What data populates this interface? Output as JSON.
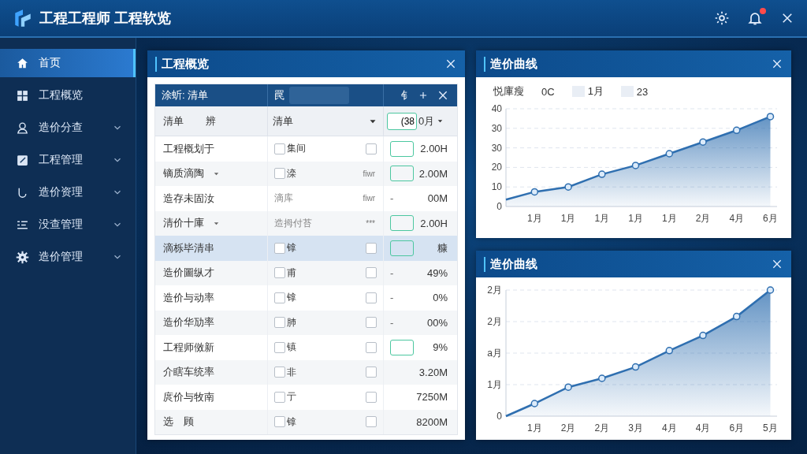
{
  "app": {
    "title": "工程工程师 工程软览",
    "notification": true
  },
  "sidebar": {
    "items": [
      {
        "label": "首页",
        "selected": true
      },
      {
        "label": "工程概览",
        "selected": false
      },
      {
        "label": "造价分查",
        "selected": false,
        "chevron": true
      },
      {
        "label": "工程管理",
        "selected": false,
        "chevron": true
      },
      {
        "label": "造价资理",
        "selected": false,
        "chevron": true
      },
      {
        "label": "没查管理",
        "selected": false,
        "chevron": true
      },
      {
        "label": "造价管理",
        "selected": false,
        "chevron": true
      }
    ]
  },
  "overview": {
    "title": "工程概览",
    "toolbar": {
      "label": "涂蚚: 清单",
      "search_label": "罠",
      "tool": "钅"
    },
    "filters": {
      "name": "清单",
      "name_2": "辨",
      "select": "清单",
      "field": "(38",
      "month": "0月"
    },
    "rows": [
      {
        "name": "工程概划于",
        "checkbox": {
          "checked": false
        },
        "text": "集间",
        "flag": {
          "kind": "checkbox",
          "checked": false
        },
        "field": true,
        "value": "2.00H",
        "selected": false
      },
      {
        "name": "镝质滴陶",
        "caret": true,
        "checkbox": {
          "checked": false
        },
        "text": "滦",
        "flag": {
          "kind": "text",
          "text": "fiwr"
        },
        "field": true,
        "value": "2.00M",
        "selected": false
      },
      {
        "name": "造存未固汝",
        "text": "滴库",
        "flag": {
          "kind": "text",
          "text": "fiwr"
        },
        "prefix": "-",
        "value": "00M",
        "selected": false
      },
      {
        "name": "清价十庫",
        "caret": true,
        "text": "造拇付苔",
        "flag": {
          "kind": "text",
          "text": "***"
        },
        "field": true,
        "value": "2.00H",
        "selected": false
      },
      {
        "name": "滴栎毕清串",
        "checkbox": {
          "checked": false
        },
        "text": "镎",
        "flag": {
          "kind": "checkbox",
          "checked": false
        },
        "field": true,
        "value": "糠",
        "selected": true
      },
      {
        "name": "造价圖纵才",
        "checkbox": {
          "checked": false
        },
        "text": "甫",
        "flag": {
          "kind": "checkbox",
          "checked": false
        },
        "prefix": "-",
        "value": "49%",
        "selected": false
      },
      {
        "name": "造价与动率",
        "checkbox": {
          "checked": false
        },
        "text": "镎",
        "flag": {
          "kind": "checkbox",
          "checked": false
        },
        "prefix": "-",
        "value": "0%",
        "selected": false
      },
      {
        "name": "造价华劢率",
        "checkbox": {
          "checked": false
        },
        "text": "肺",
        "flag": {
          "kind": "checkbox",
          "checked": false
        },
        "prefix": "-",
        "value": "00%",
        "selected": false
      },
      {
        "name": "工程师傚新",
        "checkbox": {
          "checked": false
        },
        "text": "镇",
        "flag": {
          "kind": "checkbox",
          "checked": false
        },
        "field": true,
        "value": "9%",
        "selected": false
      },
      {
        "name": "介瞎车统率",
        "checkbox": {
          "checked": false
        },
        "text": "非",
        "flag": {
          "kind": "checkbox",
          "checked": false
        },
        "value": "3.20M",
        "selected": false
      },
      {
        "name": "庹价与牧南",
        "checkbox": {
          "checked": false
        },
        "text": "亍",
        "flag": {
          "kind": "checkbox",
          "checked": false
        },
        "value": "7250M",
        "selected": false
      },
      {
        "name": "选　顾",
        "checkbox": {
          "checked": false
        },
        "text": "镎",
        "flag": {
          "kind": "checkbox",
          "checked": false
        },
        "value": "8200M",
        "selected": false
      }
    ]
  },
  "charts": [
    {
      "title": "造价曲线",
      "legend": [
        {
          "label": "悦庫瘦"
        },
        {
          "label": "0C"
        },
        {
          "label": "1月",
          "swatch": true
        },
        {
          "label": "23",
          "swatch": true
        }
      ],
      "y_labels": [
        "40",
        "30",
        "30",
        "20",
        "10",
        "0"
      ],
      "x_labels": [
        "1月",
        "1月",
        "1月",
        "1月",
        "1月",
        "2月",
        "4月",
        "6月"
      ]
    },
    {
      "title": "造价曲线",
      "y_labels": [
        "2月",
        "2月",
        "a月",
        "1月",
        "0"
      ],
      "x_labels": [
        "1月",
        "2月",
        "2月",
        "3月",
        "4月",
        "4月",
        "6月",
        "5月"
      ]
    }
  ]
}
